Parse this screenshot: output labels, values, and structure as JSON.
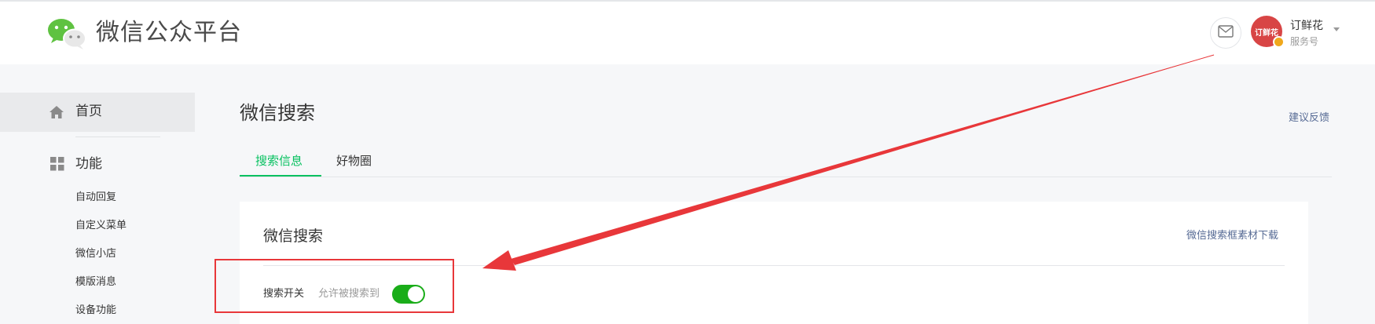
{
  "header": {
    "logo_text": "微信公众平台",
    "account": {
      "name": "订鲜花",
      "type": "服务号",
      "avatar_text": "订鲜花"
    }
  },
  "sidebar": {
    "home_label": "首页",
    "function_label": "功能",
    "items": [
      {
        "label": "自动回复"
      },
      {
        "label": "自定义菜单"
      },
      {
        "label": "微信小店"
      },
      {
        "label": "模版消息"
      },
      {
        "label": "设备功能"
      }
    ]
  },
  "main": {
    "title": "微信搜索",
    "feedback_link": "建议反馈",
    "tabs": [
      {
        "label": "搜索信息",
        "active": true
      },
      {
        "label": "好物圈",
        "active": false
      }
    ],
    "card": {
      "title": "微信搜索",
      "download_link": "微信搜索框素材下载",
      "switch_label": "搜索开关",
      "switch_desc": "允许被搜索到",
      "switch_on": true
    }
  },
  "colors": {
    "accent_green": "#07c160",
    "toggle_green": "#1aad19",
    "link_blue": "#576b95",
    "annotation_red": "#e8373a"
  }
}
